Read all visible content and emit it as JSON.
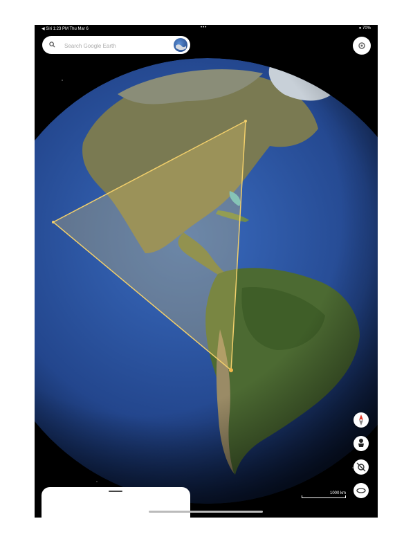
{
  "status_bar": {
    "left": "◀ Siri 1:23 PM Thu Mar 6",
    "center": "•••",
    "right": "● 70%"
  },
  "search": {
    "placeholder": "Search Google Earth",
    "icon": "search-icon"
  },
  "controls": {
    "settings": "gear-icon",
    "compass": "compass-icon",
    "pegman": "street-view-icon",
    "my_location": "location-off-icon",
    "view_3d": "3d-view-icon"
  },
  "scale": {
    "label": "1000 km"
  },
  "colors": {
    "measure_polygon": "#f2cf6b",
    "ocean": "#2d56a6",
    "compass_needle": "#e0392b"
  }
}
